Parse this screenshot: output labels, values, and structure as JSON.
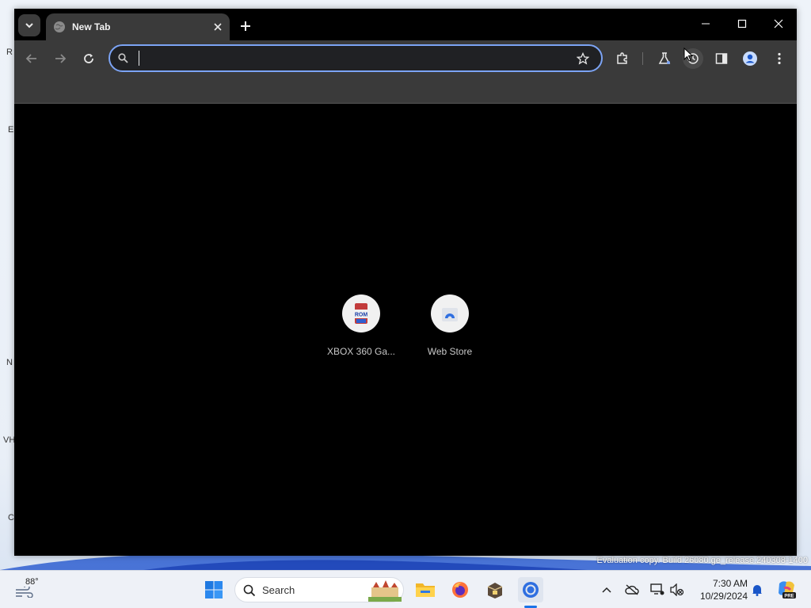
{
  "browser": {
    "tab": {
      "title": "New Tab"
    },
    "omnibox": {
      "value": "",
      "placeholder": ""
    },
    "shortcuts": [
      {
        "label": "XBOX 360 Ga...",
        "icon": "rom-cartridge-icon"
      },
      {
        "label": "Web Store",
        "icon": "web-store-icon"
      }
    ]
  },
  "desktop": {
    "watermark": "Evaluation copy. Build 26080.ge_release.240308-1400",
    "edge_labels": [
      "R",
      "E",
      "N",
      "VH",
      "C"
    ]
  },
  "taskbar": {
    "weather_temp": "88°",
    "search_label": "Search",
    "clock_time": "7:30 AM",
    "clock_date": "10/29/2024",
    "copilot_badge": "PRE"
  },
  "colors": {
    "accent": "#7ca4f5",
    "toolbar": "#3a3a3a",
    "content": "#000000"
  }
}
